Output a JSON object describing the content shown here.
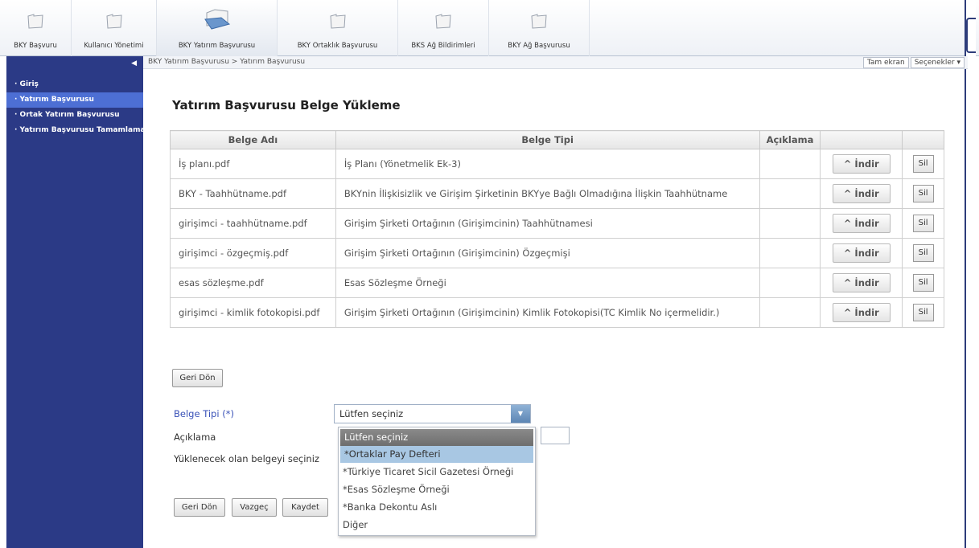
{
  "toolbar": {
    "items": [
      {
        "label": "BKY Başvuru",
        "icon": "folder-icon"
      },
      {
        "label": "Kullanıcı Yönetimi",
        "icon": "folder-icon"
      },
      {
        "label": "BKY Yatırım Başvurusu",
        "icon": "folder-open-icon"
      },
      {
        "label": "BKY Ortaklık Başvurusu",
        "icon": "folder-icon"
      },
      {
        "label": "BKS Ağ Bildirimleri",
        "icon": "folder-icon"
      },
      {
        "label": "BKY Ağ Başvurusu",
        "icon": "folder-icon"
      }
    ]
  },
  "sidebar": {
    "items": [
      {
        "label": "· Giriş"
      },
      {
        "label": "· Yatırım Başvurusu"
      },
      {
        "label": "· Ortak Yatırım Başvurusu"
      },
      {
        "label": "· Yatırım Başvurusu Tamamlama/"
      }
    ]
  },
  "breadcrumb": {
    "text": "BKY Yatırım Başvurusu  >  Yatırım Başvurusu",
    "fullscreen": "Tam ekran",
    "options": "Seçenekler ▾"
  },
  "page": {
    "title": "Yatırım Başvurusu Belge Yükleme"
  },
  "table": {
    "headers": [
      "Belge Adı",
      "Belge Tipi",
      "Açıklama",
      "",
      ""
    ],
    "download_label": "^  İndir",
    "delete_label": "Sil",
    "rows": [
      {
        "name": "İş planı.pdf",
        "type": "İş Planı (Yönetmelik Ek-3)",
        "desc": ""
      },
      {
        "name": "BKY - Taahhütname.pdf",
        "type": "BKYnin İlişkisizlik ve Girişim Şirketinin BKYye Bağlı Olmadığına İlişkin Taahhütname",
        "desc": ""
      },
      {
        "name": "girişimci - taahhütname.pdf",
        "type": "Girişim Şirketi Ortağının (Girişimcinin) Taahhütnamesi",
        "desc": ""
      },
      {
        "name": "girişimci - özgeçmiş.pdf",
        "type": "Girişim Şirketi Ortağının (Girişimcinin) Özgeçmişi",
        "desc": ""
      },
      {
        "name": "esas sözleşme.pdf",
        "type": "Esas Sözleşme Örneği",
        "desc": ""
      },
      {
        "name": "girişimci - kimlik fotokopisi.pdf",
        "type": "Girişim Şirketi Ortağının (Girişimcinin) Kimlik Fotokopisi(TC Kimlik No içermelidir.)",
        "desc": ""
      }
    ]
  },
  "buttons": {
    "back_top": "Geri Dön",
    "back_bottom": "Geri Dön",
    "cancel": "Vazgeç",
    "save": "Kaydet"
  },
  "form": {
    "doc_type_label": "Belge Tipi (*)",
    "description_label": "Açıklama",
    "file_label": "Yüklenecek olan belgeyi seçiniz",
    "select_value": "Lütfen seçiniz"
  },
  "dropdown": {
    "options": [
      "Lütfen seçiniz",
      "*Ortaklar Pay Defteri",
      "*Türkiye Ticaret Sicil Gazetesi Örneği",
      "*Esas Sözleşme Örneği",
      "*Banka Dekontu Aslı",
      "Diğer"
    ]
  },
  "colors": {
    "sidebar": "#2b3a86",
    "sidebar_active": "#4d6fd4",
    "label_link": "#3a52b8"
  }
}
